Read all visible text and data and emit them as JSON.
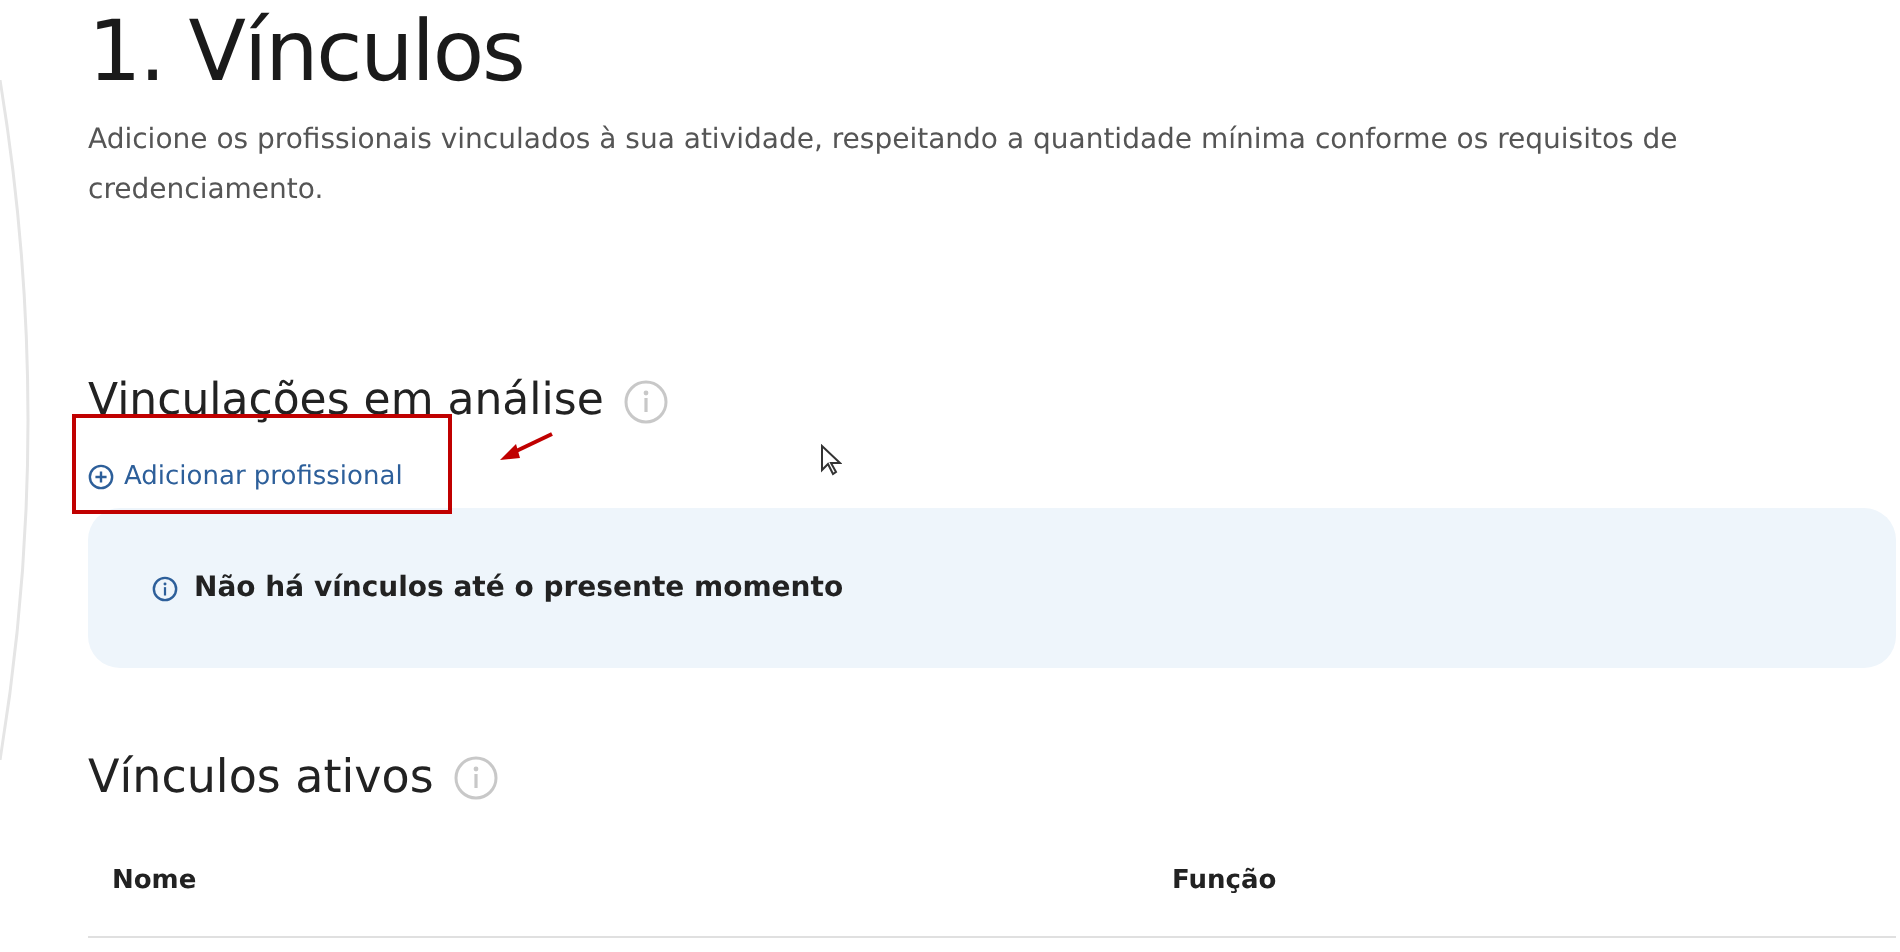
{
  "page": {
    "title": "1. Vínculos",
    "description": "Adicione os profissionais vinculados à sua atividade, respeitando a quantidade mínima conforme os requisitos de credenciamento."
  },
  "pending_section": {
    "heading": "Vinculações em análise",
    "add_link": "Adicionar profissional",
    "empty_message": "Não há vínculos até o presente momento"
  },
  "active_section": {
    "heading": "Vínculos ativos",
    "table": {
      "columns": [
        "Nome",
        "Função"
      ]
    }
  }
}
